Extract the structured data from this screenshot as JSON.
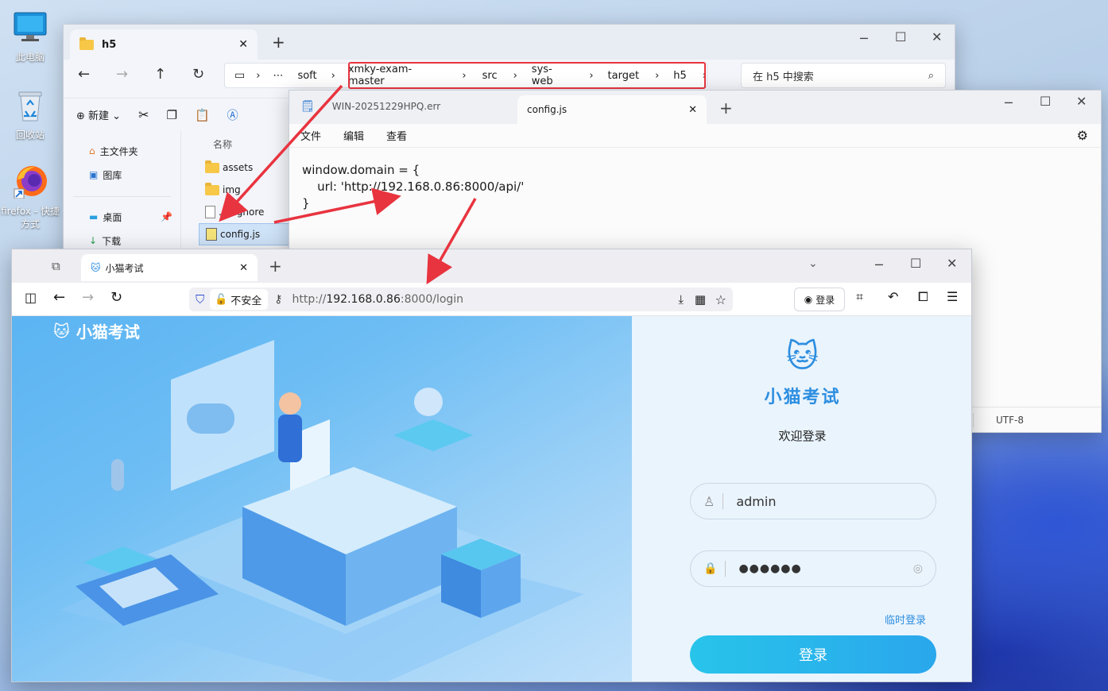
{
  "desktop": {
    "icons": [
      {
        "label": "此电脑"
      },
      {
        "label": "回收站"
      },
      {
        "label": "firefox - 快捷方式"
      }
    ]
  },
  "explorer": {
    "tab_title": "h5",
    "breadcrumb": [
      "soft",
      "xmky-exam-master",
      "src",
      "sys-web",
      "target",
      "h5"
    ],
    "search_placeholder": "在 h5 中搜索",
    "toolbar_new": "新建",
    "nav": [
      "主文件夹",
      "图库",
      "桌面",
      "下载"
    ],
    "files_header": "名称",
    "files": [
      "assets",
      "img",
      ".gitignore",
      "config.js"
    ]
  },
  "notepad": {
    "tabs": [
      "WIN-20251229HPQ.err",
      "config.js"
    ],
    "menu": [
      "文件",
      "编辑",
      "查看"
    ],
    "code_lines": [
      "window.domain = {",
      "    url: 'http://192.168.0.86:8000/api/'",
      "}"
    ],
    "encoding": "UTF-8"
  },
  "browser": {
    "tab_title": "小猫考试",
    "insecure_label": "不安全",
    "url_prefix": "http://",
    "url_host": "192.168.0.86",
    "url_rest": ":8000/login",
    "login_button_label": "登录",
    "page": {
      "brand": "小猫考试",
      "logo_title": "小猫考试",
      "welcome": "欢迎登录",
      "username_value": "admin",
      "password_masked": "●●●●●●",
      "temp_login": "临时登录",
      "submit": "登录"
    }
  },
  "colors": {
    "highlight_red": "#e8343f",
    "primary_blue": "#2aa7ec",
    "brand_blue": "#2d8ee0"
  }
}
